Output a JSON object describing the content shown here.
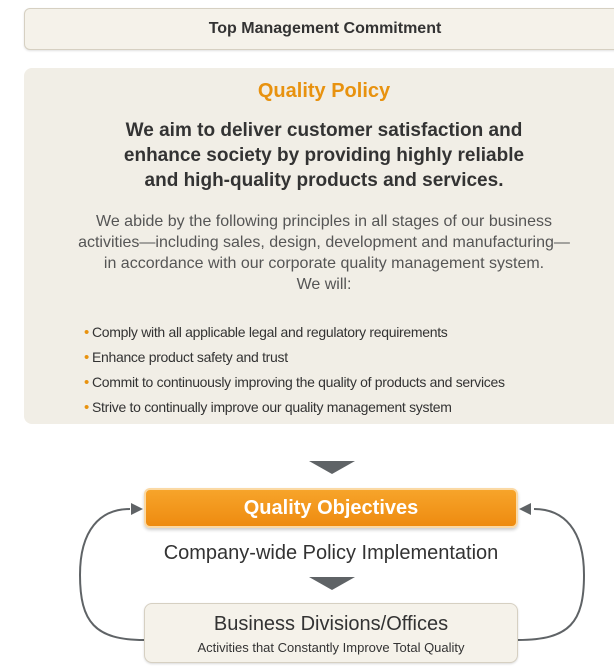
{
  "top_box": {
    "label": "Top Management Commitment"
  },
  "policy": {
    "title": "Quality Policy",
    "statement": [
      "We aim to deliver customer satisfaction and",
      "enhance society by providing highly reliable",
      "and high-quality products and services."
    ],
    "principles": [
      "We abide by the following principles in all stages of our business",
      "activities—including sales, design, development and manufacturing—",
      "in accordance with our corporate quality management system.",
      "We will:"
    ],
    "bullets": [
      "Comply with all applicable legal and regulatory requirements",
      "Enhance product safety and trust",
      "Commit to continuously improving the quality of products and services",
      "Strive to continually improve our quality management system"
    ]
  },
  "objectives": {
    "label": "Quality Objectives"
  },
  "implementation": {
    "label": "Company-wide Policy Implementation"
  },
  "divisions": {
    "title": "Business Divisions/Offices",
    "subtitle": "Activities that Constantly Improve Total Quality"
  },
  "colors": {
    "accent_orange": "#e8920f",
    "box_beige": "#f1eee6",
    "arrow_gray": "#5f6366",
    "text_dark": "#333333"
  }
}
